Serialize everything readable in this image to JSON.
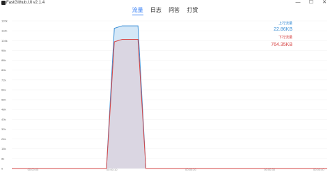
{
  "window": {
    "title": "FastGithub.UI v2.1.4",
    "controls": {
      "minimize": "—",
      "maximize": "☐",
      "close": "✕"
    }
  },
  "tabs": [
    {
      "label": "流量",
      "active": true
    },
    {
      "label": "日志",
      "active": false
    },
    {
      "label": "问答",
      "active": false
    },
    {
      "label": "打赏",
      "active": false
    }
  ],
  "legend": {
    "upload_label": "上行流量",
    "upload_value": "22.86KB",
    "download_label": "下行流量",
    "download_value": "764.35KB"
  },
  "colors": {
    "upload": "#3b8fd6",
    "upload_fill": "#cfe4f6",
    "download": "#d64545",
    "download_fill": "#dcd0db",
    "accent": "#3b82f6"
  },
  "chart_data": {
    "type": "area",
    "y_ticks": [
      "0",
      "8k",
      "16k",
      "24k",
      "32k",
      "40k",
      "48k",
      "56k",
      "64k",
      "72k",
      "80k",
      "88k",
      "96k",
      "104k",
      "112k",
      "120k"
    ],
    "x_ticks": [
      "00:00:00",
      "00:00:10",
      "00:00:20",
      "00:00:30",
      "00:00:40"
    ],
    "x": [
      0,
      1,
      2,
      3,
      4,
      5,
      6,
      7,
      8,
      9,
      10,
      11,
      12,
      13,
      14,
      15,
      16,
      17,
      18,
      19,
      20,
      21,
      22,
      23,
      24,
      25,
      26,
      27,
      28,
      29,
      30,
      31,
      32,
      33,
      34,
      35,
      36,
      37,
      38,
      39,
      40
    ],
    "series": [
      {
        "name": "上行流量",
        "values": [
          0,
          0,
          0,
          0,
          0,
          0,
          0,
          0,
          0,
          0,
          0,
          0,
          0,
          114,
          116,
          116,
          116,
          0,
          0,
          0,
          0,
          0,
          0,
          0,
          0,
          0,
          0,
          0,
          0,
          0,
          0,
          0,
          0,
          0,
          0,
          0,
          0,
          0,
          0,
          0,
          0
        ]
      },
      {
        "name": "下行流量",
        "values": [
          0,
          0,
          0,
          0,
          0,
          0,
          0,
          0,
          0,
          0,
          0,
          0,
          0,
          103,
          105,
          105,
          105,
          0,
          0,
          0,
          0,
          0,
          0,
          0,
          0,
          0,
          0,
          0,
          0,
          0,
          0,
          0,
          0,
          0,
          0,
          0,
          0,
          0,
          0,
          0,
          0
        ]
      }
    ],
    "ylim": [
      0,
      120
    ]
  }
}
